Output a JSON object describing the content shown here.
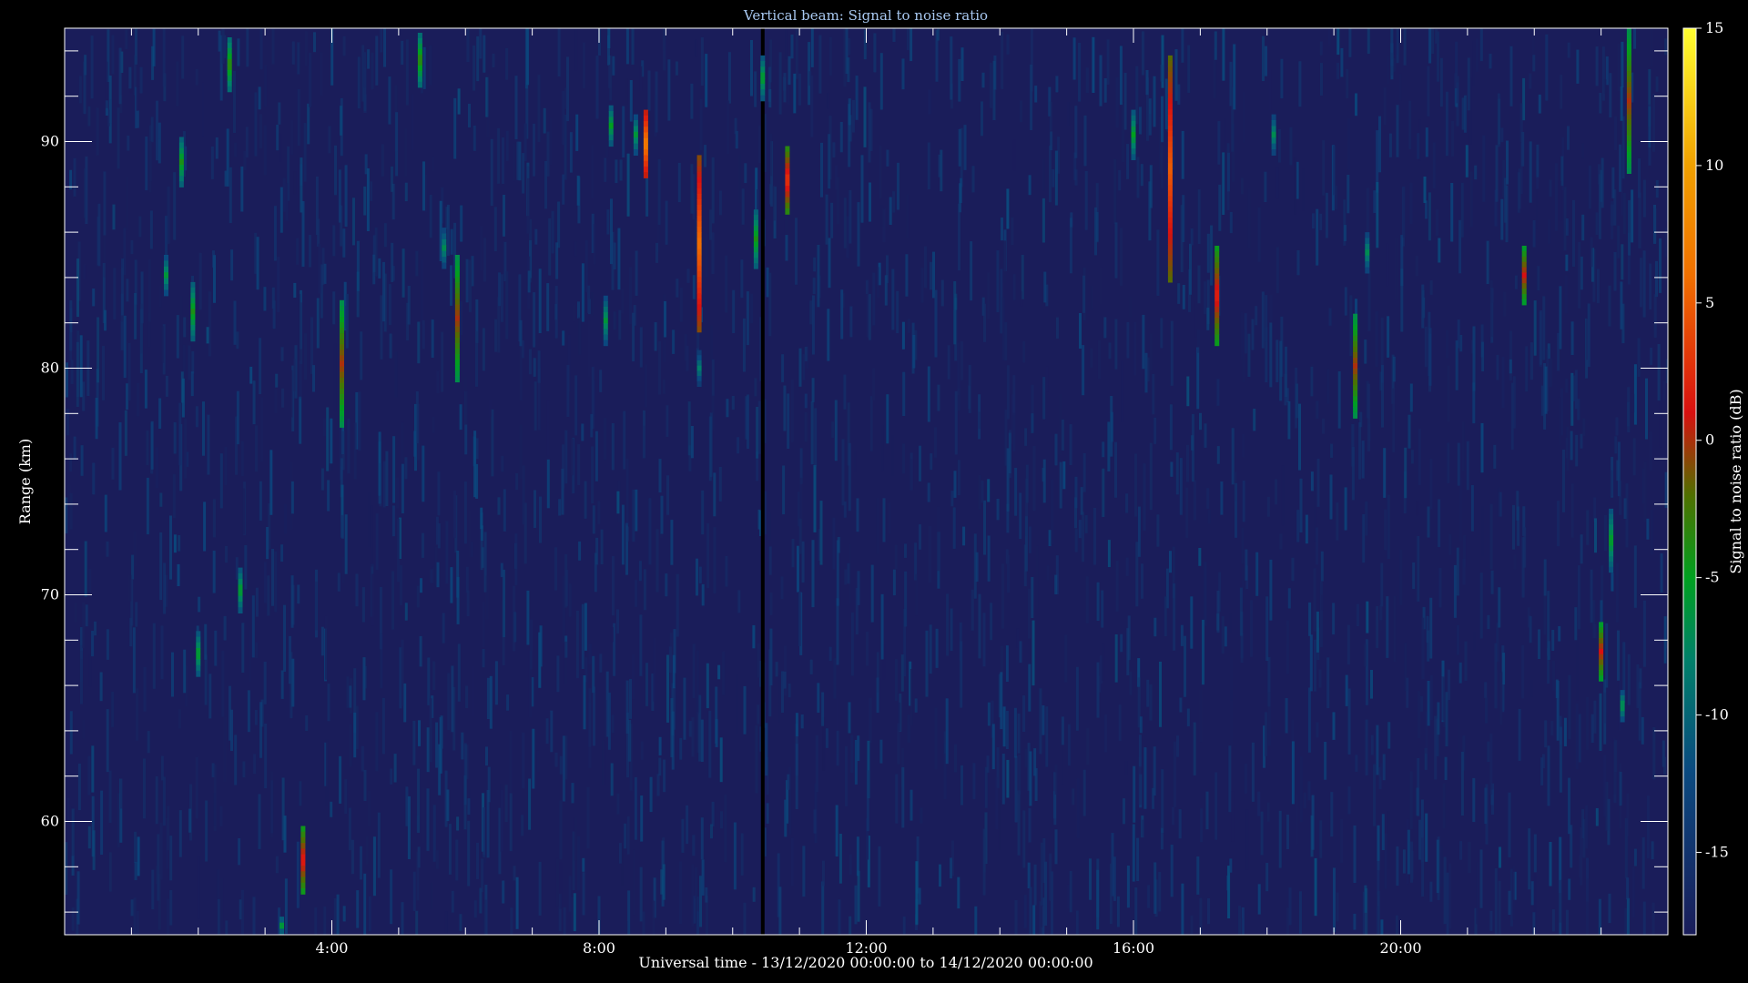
{
  "chart_data": {
    "type": "heatmap",
    "title": "Vertical beam: Signal to noise ratio",
    "xlabel": "Universal time - 13/12/2020 00:00:00 to 14/12/2020 00:00:00",
    "ylabel": "Range (km)",
    "xlim": [
      0,
      24
    ],
    "ylim": [
      55,
      95
    ],
    "x_ticks": [
      {
        "value": 4,
        "label": "4:00"
      },
      {
        "value": 8,
        "label": "8:00"
      },
      {
        "value": 12,
        "label": "12:00"
      },
      {
        "value": 16,
        "label": "16:00"
      },
      {
        "value": 20,
        "label": "20:00"
      }
    ],
    "y_ticks": [
      {
        "value": 60,
        "label": "60"
      },
      {
        "value": 70,
        "label": "70"
      },
      {
        "value": 80,
        "label": "80"
      },
      {
        "value": 90,
        "label": "90"
      }
    ],
    "colorbar": {
      "label": "Signal to noise ratio (dB)",
      "range": [
        -18,
        15
      ],
      "ticks": [
        {
          "value": 15,
          "label": "15"
        },
        {
          "value": 10,
          "label": "10"
        },
        {
          "value": 5,
          "label": "5"
        },
        {
          "value": 0,
          "label": "0"
        },
        {
          "value": -5,
          "label": "-5"
        },
        {
          "value": -10,
          "label": "-10"
        },
        {
          "value": -15,
          "label": "-15"
        }
      ],
      "stops": [
        {
          "value": -18,
          "color": "#1a1d5a"
        },
        {
          "value": -12,
          "color": "#0a4a80"
        },
        {
          "value": -8,
          "color": "#00806a"
        },
        {
          "value": -5,
          "color": "#00a020"
        },
        {
          "value": -2,
          "color": "#507000"
        },
        {
          "value": 1,
          "color": "#d81010"
        },
        {
          "value": 6,
          "color": "#f07000"
        },
        {
          "value": 10,
          "color": "#f0a000"
        },
        {
          "value": 15,
          "color": "#ffff30"
        }
      ]
    },
    "background_level_db": -16,
    "data_gap_time": 10.45,
    "echoes": [
      {
        "time": 1.52,
        "range_min": 83.2,
        "range_max": 85.0,
        "snr_db": -6
      },
      {
        "time": 1.75,
        "range_min": 88.0,
        "range_max": 90.2,
        "snr_db": -4
      },
      {
        "time": 1.92,
        "range_min": 81.2,
        "range_max": 83.8,
        "snr_db": -4
      },
      {
        "time": 2.0,
        "range_min": 66.4,
        "range_max": 68.4,
        "snr_db": -5
      },
      {
        "time": 2.47,
        "range_min": 92.2,
        "range_max": 94.6,
        "snr_db": -3
      },
      {
        "time": 2.63,
        "range_min": 69.2,
        "range_max": 71.2,
        "snr_db": -5
      },
      {
        "time": 3.25,
        "range_min": 55.0,
        "range_max": 55.8,
        "snr_db": -6
      },
      {
        "time": 3.57,
        "range_min": 56.8,
        "range_max": 59.8,
        "snr_db": 2
      },
      {
        "time": 4.15,
        "range_min": 77.4,
        "range_max": 83.0,
        "snr_db": 0
      },
      {
        "time": 5.32,
        "range_min": 92.4,
        "range_max": 94.8,
        "snr_db": -3
      },
      {
        "time": 5.68,
        "range_min": 84.4,
        "range_max": 86.2,
        "snr_db": -7
      },
      {
        "time": 5.88,
        "range_min": 79.4,
        "range_max": 85.0,
        "snr_db": 0
      },
      {
        "time": 8.1,
        "range_min": 81.0,
        "range_max": 83.2,
        "snr_db": -6
      },
      {
        "time": 8.18,
        "range_min": 89.8,
        "range_max": 91.6,
        "snr_db": -5
      },
      {
        "time": 8.55,
        "range_min": 89.4,
        "range_max": 91.2,
        "snr_db": -6
      },
      {
        "time": 8.7,
        "range_min": 88.4,
        "range_max": 91.4,
        "snr_db": 7
      },
      {
        "time": 9.5,
        "range_min": 79.2,
        "range_max": 80.8,
        "snr_db": -8
      },
      {
        "time": 9.5,
        "range_min": 81.6,
        "range_max": 89.4,
        "snr_db": 6
      },
      {
        "time": 10.35,
        "range_min": 84.4,
        "range_max": 87.0,
        "snr_db": -4
      },
      {
        "time": 10.45,
        "range_min": 91.8,
        "range_max": 93.8,
        "snr_db": -5
      },
      {
        "time": 10.82,
        "range_min": 86.8,
        "range_max": 89.8,
        "snr_db": 3
      },
      {
        "time": 16.0,
        "range_min": 89.2,
        "range_max": 91.4,
        "snr_db": -5
      },
      {
        "time": 16.55,
        "range_min": 83.8,
        "range_max": 93.8,
        "snr_db": 5
      },
      {
        "time": 17.25,
        "range_min": 81.0,
        "range_max": 85.4,
        "snr_db": 2
      },
      {
        "time": 18.1,
        "range_min": 89.4,
        "range_max": 91.2,
        "snr_db": -7
      },
      {
        "time": 19.32,
        "range_min": 77.8,
        "range_max": 82.4,
        "snr_db": 0
      },
      {
        "time": 19.5,
        "range_min": 84.2,
        "range_max": 86.0,
        "snr_db": -7
      },
      {
        "time": 21.85,
        "range_min": 82.8,
        "range_max": 85.4,
        "snr_db": 1
      },
      {
        "time": 23.0,
        "range_min": 66.2,
        "range_max": 68.8,
        "snr_db": 1
      },
      {
        "time": 23.15,
        "range_min": 71.0,
        "range_max": 73.8,
        "snr_db": -5
      },
      {
        "time": 23.32,
        "range_min": 64.4,
        "range_max": 65.8,
        "snr_db": -6
      },
      {
        "time": 23.42,
        "range_min": 88.6,
        "range_max": 95.0,
        "snr_db": 0
      }
    ]
  }
}
